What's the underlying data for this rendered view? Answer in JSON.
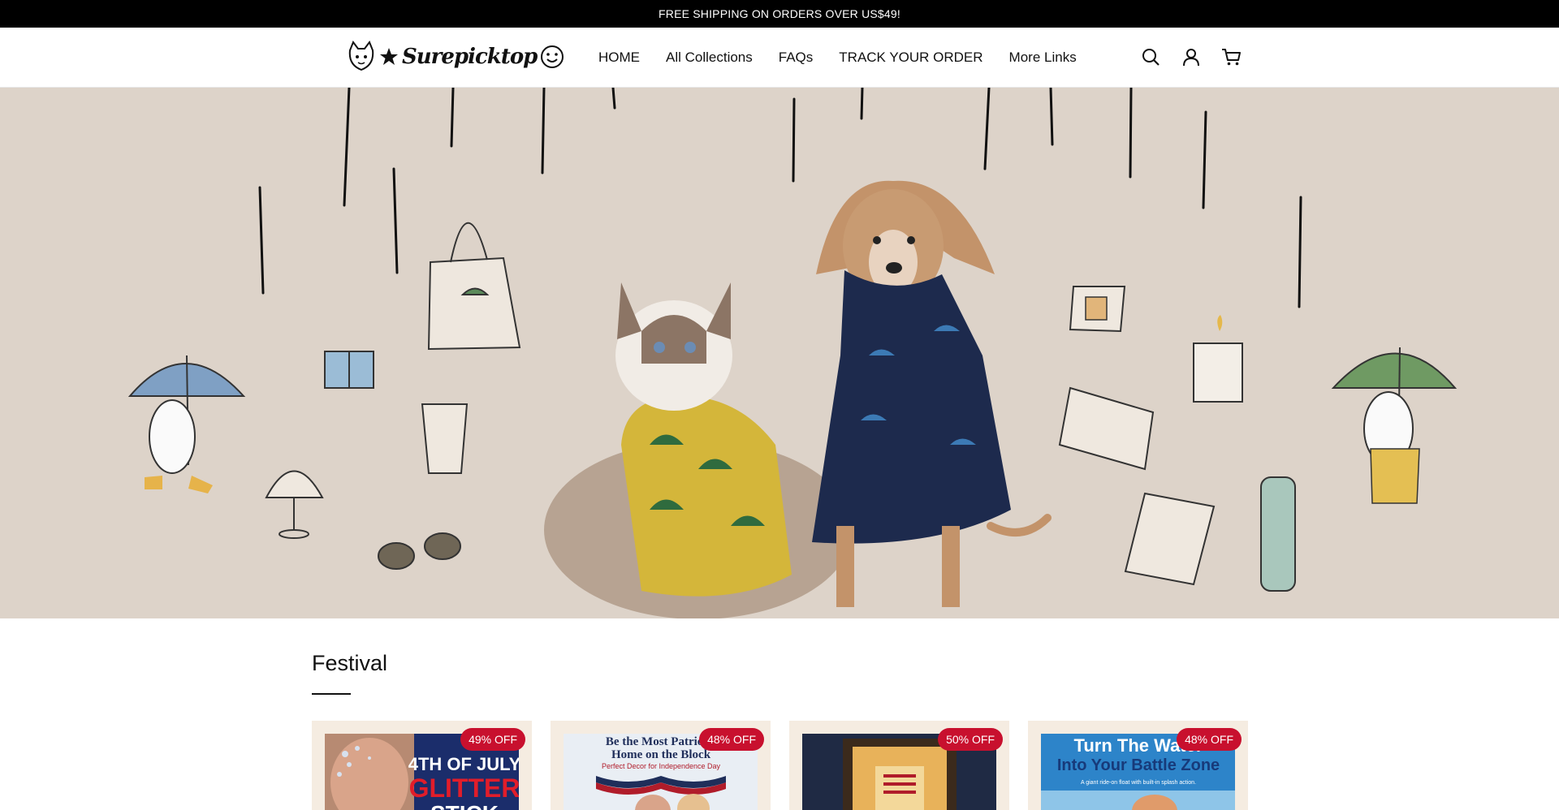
{
  "announcement": "FREE SHIPPING ON ORDERS OVER US$49!",
  "brand": {
    "name": "Surepicktop"
  },
  "nav": [
    {
      "label": "HOME"
    },
    {
      "label": "All Collections"
    },
    {
      "label": "FAQs"
    },
    {
      "label": "TRACK YOUR ORDER"
    },
    {
      "label": "More Links"
    }
  ],
  "header_icons": [
    "search-icon",
    "account-icon",
    "cart-icon"
  ],
  "section": {
    "title": "Festival",
    "products": [
      {
        "badge": "49% OFF",
        "image_text": [
          "4TH OF JULY",
          "GLITTER",
          "STICK"
        ]
      },
      {
        "badge": "48% OFF",
        "image_text": [
          "Be the Most Patriotic",
          "Home on the Block",
          "Perfect Decor for Independence Day"
        ]
      },
      {
        "badge": "50% OFF",
        "image_text": []
      },
      {
        "badge": "48% OFF",
        "image_text": [
          "Turn The Water",
          "Into Your Battle Zone",
          "A giant ride-on float with built-in splash action."
        ]
      }
    ]
  },
  "colors": {
    "announce_bg": "#000000",
    "hero_bg": "#ddd3c9",
    "badge": "#c8102e",
    "card_bg": "#f5ece1"
  }
}
